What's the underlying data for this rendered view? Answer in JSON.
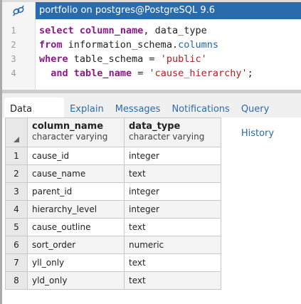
{
  "title": "portfolio on postgres@PostgreSQL 9.6",
  "editor": {
    "line_numbers": [
      "1",
      "2",
      "3",
      "4"
    ],
    "lines": [
      [
        {
          "t": "select",
          "c": "kw"
        },
        {
          "t": " "
        },
        {
          "t": "column_name",
          "c": "kw"
        },
        {
          "t": ", data_type"
        }
      ],
      [
        {
          "t": "from",
          "c": "kw"
        },
        {
          "t": " information_schema."
        },
        {
          "t": "columns",
          "c": "prop"
        }
      ],
      [
        {
          "t": "where",
          "c": "kw"
        },
        {
          "t": " table_schema = "
        },
        {
          "t": "'public'",
          "c": "str"
        }
      ],
      [
        {
          "t": "  "
        },
        {
          "t": "and",
          "c": "kw"
        },
        {
          "t": " "
        },
        {
          "t": "table_name",
          "c": "kw"
        },
        {
          "t": " = "
        },
        {
          "t": "'cause_hierarchy'",
          "c": "str"
        },
        {
          "t": ";"
        }
      ]
    ]
  },
  "tabs": [
    "Data Output",
    "Explain",
    "Messages",
    "Notifications",
    "Query History"
  ],
  "table": {
    "columns": [
      {
        "name": "column_name",
        "type": "character varying"
      },
      {
        "name": "data_type",
        "type": "character varying"
      }
    ],
    "rows": [
      [
        "1",
        "cause_id",
        "integer"
      ],
      [
        "2",
        "cause_name",
        "text"
      ],
      [
        "3",
        "parent_id",
        "integer"
      ],
      [
        "4",
        "hierarchy_level",
        "integer"
      ],
      [
        "5",
        "cause_outline",
        "text"
      ],
      [
        "6",
        "sort_order",
        "numeric"
      ],
      [
        "7",
        "yll_only",
        "text"
      ],
      [
        "8",
        "yld_only",
        "text"
      ]
    ]
  }
}
